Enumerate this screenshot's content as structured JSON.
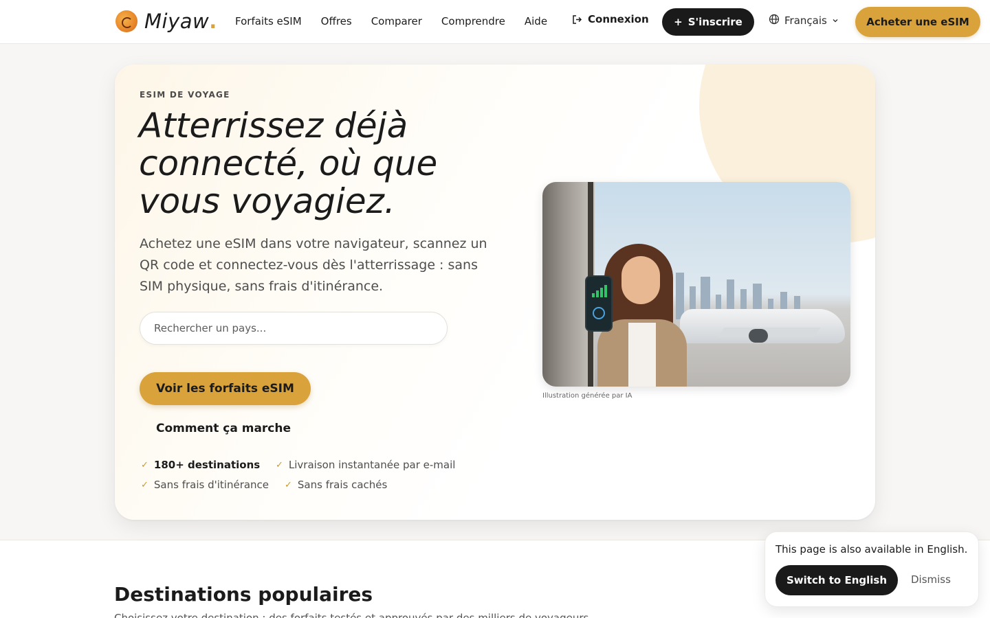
{
  "header": {
    "logo_text": "Miyaw",
    "logo_dot": ".",
    "nav": [
      "Forfaits eSIM",
      "Offres",
      "Comparer",
      "Comprendre",
      "Aide"
    ],
    "login_label": "Connexion",
    "signup_label": "S'inscrire",
    "language": "Français",
    "buy_label": "Acheter une eSIM"
  },
  "hero": {
    "eyebrow": "ESIM DE VOYAGE",
    "headline": "Atterrissez déjà connecté, où que vous voyagiez.",
    "subtitle": "Achetez une eSIM dans votre navigateur, scannez un QR code et connectez-vous dès l'atterrissage : sans SIM physique, sans frais d'itinérance.",
    "search_placeholder": "Rechercher un pays...",
    "cta_label": "Voir les forfaits eSIM",
    "how_label": "Comment ça marche",
    "features": [
      "180+ destinations",
      "Livraison instantanée par e-mail",
      "Sans frais d'itinérance",
      "Sans frais cachés"
    ],
    "image_caption": "Illustration générée par IA"
  },
  "section": {
    "title": "Destinations populaires",
    "subtitle": "Choisissez votre destination : des forfaits testés et approuvés par des milliers de voyageurs."
  },
  "toast": {
    "message": "This page is also available in English.",
    "switch_label": "Switch to English",
    "dismiss_label": "Dismiss"
  },
  "colors": {
    "accent": "#d9a23a",
    "dark_button": "#1a1a1a",
    "check": "#c99a34"
  }
}
